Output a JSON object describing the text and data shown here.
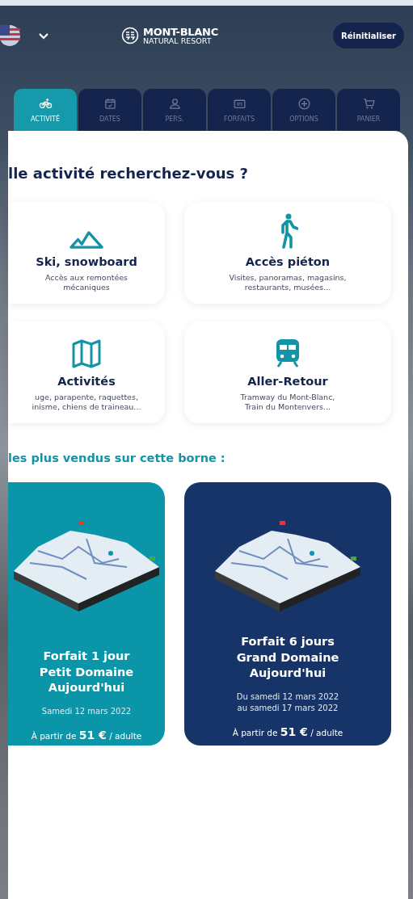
{
  "header": {
    "logo_line1": "MONT-BLANC",
    "logo_line2": "NATURAL RESORT",
    "reset_button": "Réinitialiser"
  },
  "tabs": [
    {
      "label": "ACTIVITÉ",
      "selected": true
    },
    {
      "label": "DATES",
      "selected": false
    },
    {
      "label": "PERS.",
      "selected": false
    },
    {
      "label": "FORFAITS",
      "selected": false
    },
    {
      "label": "OPTIONS",
      "selected": false
    },
    {
      "label": "PANIER",
      "selected": false
    }
  ],
  "heading": "lle activité recherchez-vous ?",
  "activities": [
    {
      "title": "Ski, snowboard",
      "description": "Accès aux remontées\nmécaniques"
    },
    {
      "title": "Accès piéton",
      "description": "Visites, panoramas, magasins,\nrestaurants, musées..."
    },
    {
      "title": "Activités",
      "description": "uge, parapente, raquettes,\ninisme, chiens de traineau..."
    },
    {
      "title": "Aller-Retour",
      "description": "Tramway du Mont-Blanc,\nTrain du Montenvers..."
    }
  ],
  "section_title": "les plus vendus sur cette borne :",
  "offers": [
    {
      "color": "#0b95a8",
      "title": "Forfait 1 jour\nPetit Domaine\nAujourd'hui",
      "dates": "Samedi 12 mars 2022",
      "price": "À partir de **51 €** / adulte"
    },
    {
      "color": "#163468",
      "title": "Forfait 6 jours\nGrand Domaine\nAujourd'hui",
      "dates": "Du samedi 12 mars 2022\nau samedi 17 mars 2022",
      "price": "À partir de **51 €** / adulte"
    }
  ]
}
